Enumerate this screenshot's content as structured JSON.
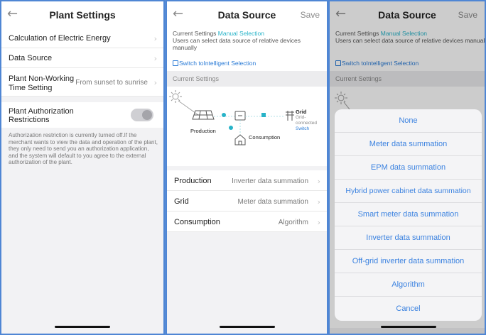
{
  "plant_settings": {
    "title": "Plant Settings",
    "back_icon": "←",
    "calc_label": "Calculation of Electric Energy",
    "data_source_label": "Data Source",
    "non_working_label_1": "Plant Non-Working",
    "non_working_label_2": "Time Setting",
    "non_working_value": "From sunset to sunrise",
    "auth_label_1": "Plant Authorization",
    "auth_label_2": "Restrictions",
    "auth_toggle_on": false,
    "auth_note": "Authorization restriction is currently turned off.If the merchant wants to view the data and operation of the plant, they only need to send you an authorization application, and the system will default to you agree to the external authorization of the plant.",
    "chevron": "›"
  },
  "data_source": {
    "title": "Data Source",
    "save_label": "Save",
    "current_prefix": "Current Settings ",
    "current_mode": "Manual Selection",
    "current_desc": "Users can select data source of relative devices manually",
    "switch_label": "Switch toIntelligent Selection",
    "section_label": "Current Settings",
    "diagram": {
      "production": "Production",
      "consumption": "Consumption",
      "grid": "Grid",
      "grid_status_1": "Grid-",
      "grid_status_2": "connected",
      "grid_switch": "Switch"
    },
    "rows": [
      {
        "label": "Production",
        "value": "Inverter data summation"
      },
      {
        "label": "Grid",
        "value": "Meter data summation"
      },
      {
        "label": "Consumption",
        "value": "Algorithm"
      }
    ]
  },
  "picker": {
    "options": [
      "None",
      "Meter data summation",
      "EPM data summation",
      "Hybrid power cabinet data summation",
      "Smart meter data summation",
      "Inverter data summation",
      "Off-grid inverter data summation",
      "Algorithm"
    ],
    "cancel_label": "Cancel"
  },
  "colors": {
    "accent": "#27b3c8",
    "link": "#2a7bd6",
    "picker_text": "#3b82e0"
  }
}
